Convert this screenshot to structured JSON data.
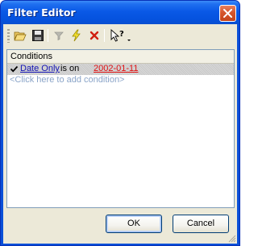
{
  "window": {
    "title": "Filter Editor",
    "title_color": "#ffffff",
    "titlebar_color": "#0a59e6"
  },
  "toolbar": {
    "items": [
      {
        "name": "open-icon",
        "enabled": true
      },
      {
        "name": "save-icon",
        "enabled": true
      },
      {
        "name": "filter-icon",
        "enabled": false
      },
      {
        "name": "apply-lightning-icon",
        "enabled": true
      },
      {
        "name": "delete-x-icon",
        "enabled": true
      },
      {
        "name": "whats-this-help-icon",
        "enabled": true
      }
    ]
  },
  "conditions": {
    "header": "Conditions",
    "rows": [
      {
        "checked": true,
        "field": "Date Only",
        "operator": "is on",
        "value": "2002-01-11"
      }
    ],
    "add_prompt": "<Click here to add condition>",
    "field_color": "#1414b4",
    "value_color": "#e01010"
  },
  "buttons": {
    "ok_label": "OK",
    "cancel_label": "Cancel"
  }
}
